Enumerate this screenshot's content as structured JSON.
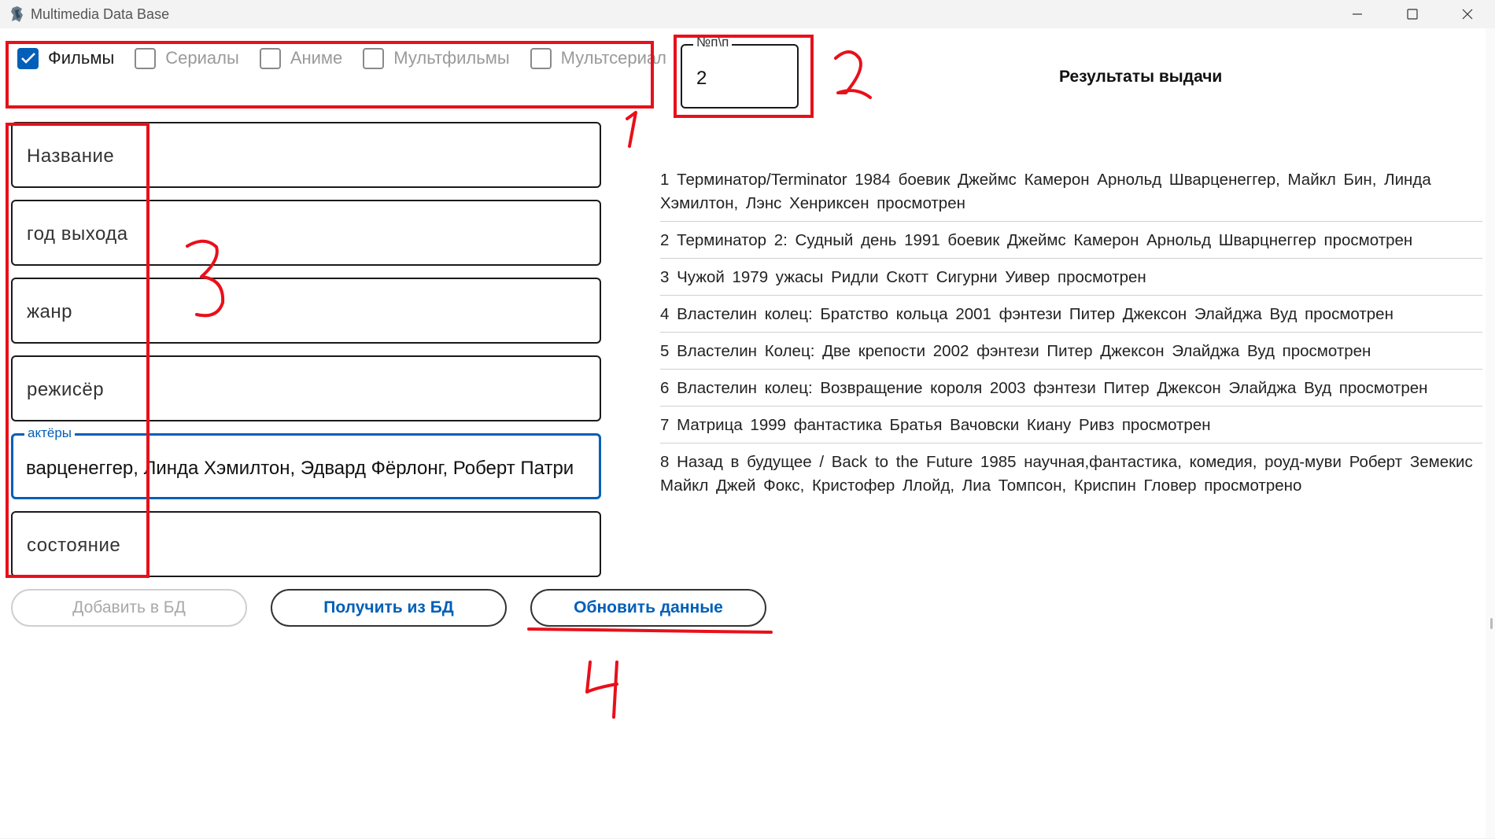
{
  "window": {
    "title": "Multimedia Data Base"
  },
  "categories": [
    {
      "label": "Фильмы",
      "checked": true
    },
    {
      "label": "Сериалы",
      "checked": false
    },
    {
      "label": "Аниме",
      "checked": false
    },
    {
      "label": "Мультфильмы",
      "checked": false
    },
    {
      "label": "Мультсериал",
      "checked": false
    }
  ],
  "number_field": {
    "legend": "№п\\п",
    "value": "2"
  },
  "results_title": "Результаты выдачи",
  "form": {
    "title_placeholder": "Название",
    "year_placeholder": "год выхода",
    "genre_placeholder": "жанр",
    "director_placeholder": "режисёр",
    "actors_legend": "актёры",
    "actors_value": "варценеггер, Линда Хэмилтон, Эдвард Фёрлонг, Роберт Патри",
    "status_placeholder": "состояние"
  },
  "buttons": {
    "add": "Добавить в БД",
    "get": "Получить из БД",
    "update": "Обновить данные"
  },
  "results": [
    "1   Терминатор/Terminator   1984   боевик   Джеймс Камерон   Арнольд Шварценеггер, Майкл Бин, Линда Хэмилтон, Лэнс Хенриксен   просмотрен",
    "2   Терминатор 2: Судный день   1991   боевик   Джеймс Камерон   Арнольд Шварцнеггер просмотрен",
    "3   Чужой   1979   ужасы   Ридли Скотт   Сигурни Уивер   просмотрен",
    "4   Властелин колец: Братство кольца   2001   фэнтези   Питер Джексон   Элайджа Вуд   просмотрен",
    "5   Властелин Колец: Две крепости   2002   фэнтези   Питер Джексон   Элайджа Вуд   просмотрен",
    "6   Властелин колец: Возвращение короля   2003   фэнтези   Питер Джексон   Элайджа Вуд просмотрен",
    "7   Матрица   1999   фантастика   Братья Вачовски   Киану Ривз   просмотрен",
    "8   Назад в будущее / Back to the Future   1985   научная,фантастика, комедия, роуд-муви   Роберт Земекис   Майкл Джей Фокс, Кристофер Ллойд, Лиа Томпсон, Криспин Гловер   просмотрено"
  ],
  "annotations": {
    "color": "#e8101a",
    "labels": [
      "1",
      "2",
      "3",
      "4"
    ]
  },
  "accent_color": "#005fb8"
}
